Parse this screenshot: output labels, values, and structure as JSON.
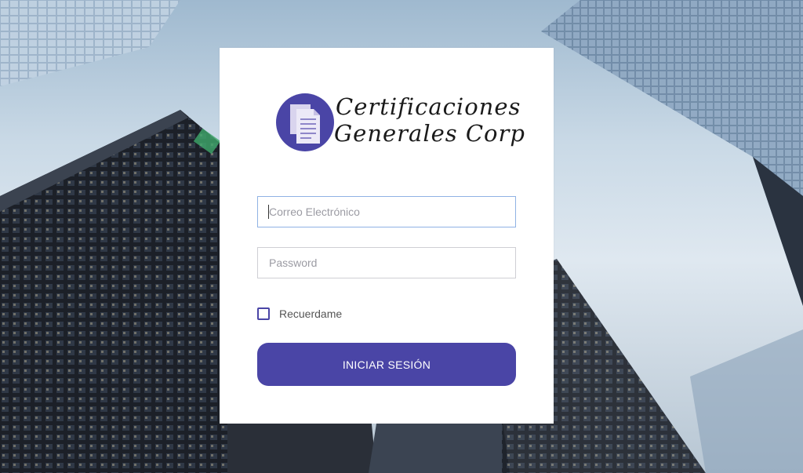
{
  "logo": {
    "line1": "Certificaciones",
    "line2": "Generales  Corp",
    "icon": "document-icon",
    "color": "#4a45a6"
  },
  "form": {
    "email_placeholder": "Correo Electrónico",
    "email_value": "",
    "password_placeholder": "Password",
    "password_value": "",
    "remember_label": "Recuerdame",
    "remember_checked": false,
    "submit_label": "INICIAR SESIÓN"
  },
  "colors": {
    "accent": "#4a45a6",
    "card": "#ffffff",
    "focus_border": "#8fb2e4"
  }
}
